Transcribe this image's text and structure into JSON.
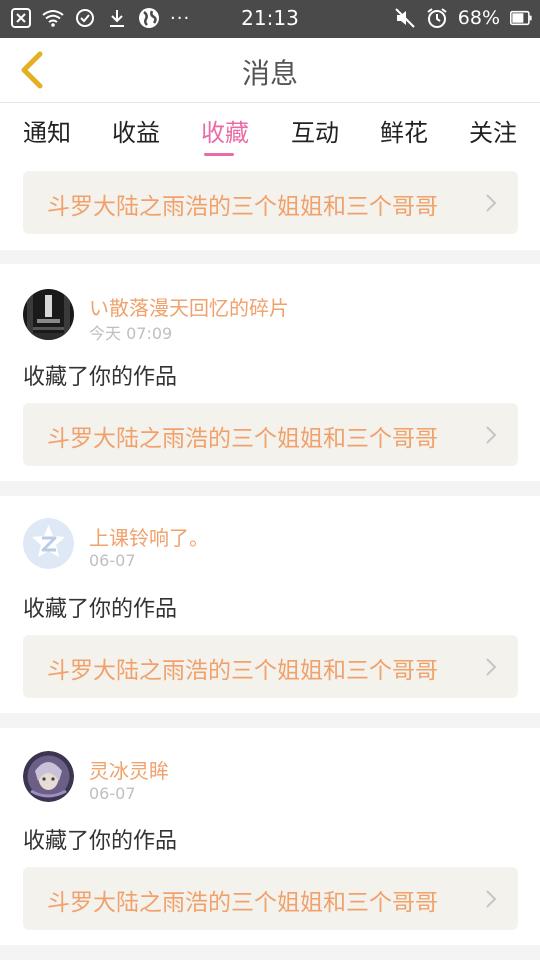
{
  "status_bar": {
    "time": "21:13",
    "battery": "68%",
    "icons": [
      "close-box-icon",
      "wifi-icon",
      "check-circle-icon",
      "download-icon",
      "globe-icon",
      "more-dots-icon",
      "mute-icon",
      "alarm-icon",
      "battery-icon"
    ],
    "dots": "···"
  },
  "header": {
    "title": "消息"
  },
  "tabs": [
    {
      "label": "通知"
    },
    {
      "label": "收益"
    },
    {
      "label": "收藏",
      "active": true
    },
    {
      "label": "互动"
    },
    {
      "label": "鲜花"
    },
    {
      "label": "关注"
    }
  ],
  "items": [
    {
      "work_title": "斗罗大陆之雨浩的三个姐姐和三个哥哥"
    },
    {
      "user": "い散落漫天回忆的碎片",
      "time": "今天 07:09",
      "action": "收藏了你的作品",
      "work_title": "斗罗大陆之雨浩的三个姐姐和三个哥哥",
      "avatar": "dark-photo-avatar"
    },
    {
      "user": "上课铃响了。",
      "time": "06-07",
      "action": "收藏了你的作品",
      "work_title": "斗罗大陆之雨浩的三个姐姐和三个哥哥",
      "avatar": "default-z-avatar"
    },
    {
      "user": "灵冰灵眸",
      "time": "06-07",
      "action": "收藏了你的作品",
      "work_title": "斗罗大陆之雨浩的三个姐姐和三个哥哥",
      "avatar": "anime-girl-avatar"
    }
  ],
  "colors": {
    "accent": "#ea6ca6",
    "title_orange": "#f0a16c",
    "back_arrow": "#e3b021",
    "link_bg": "#f4f2ec"
  }
}
